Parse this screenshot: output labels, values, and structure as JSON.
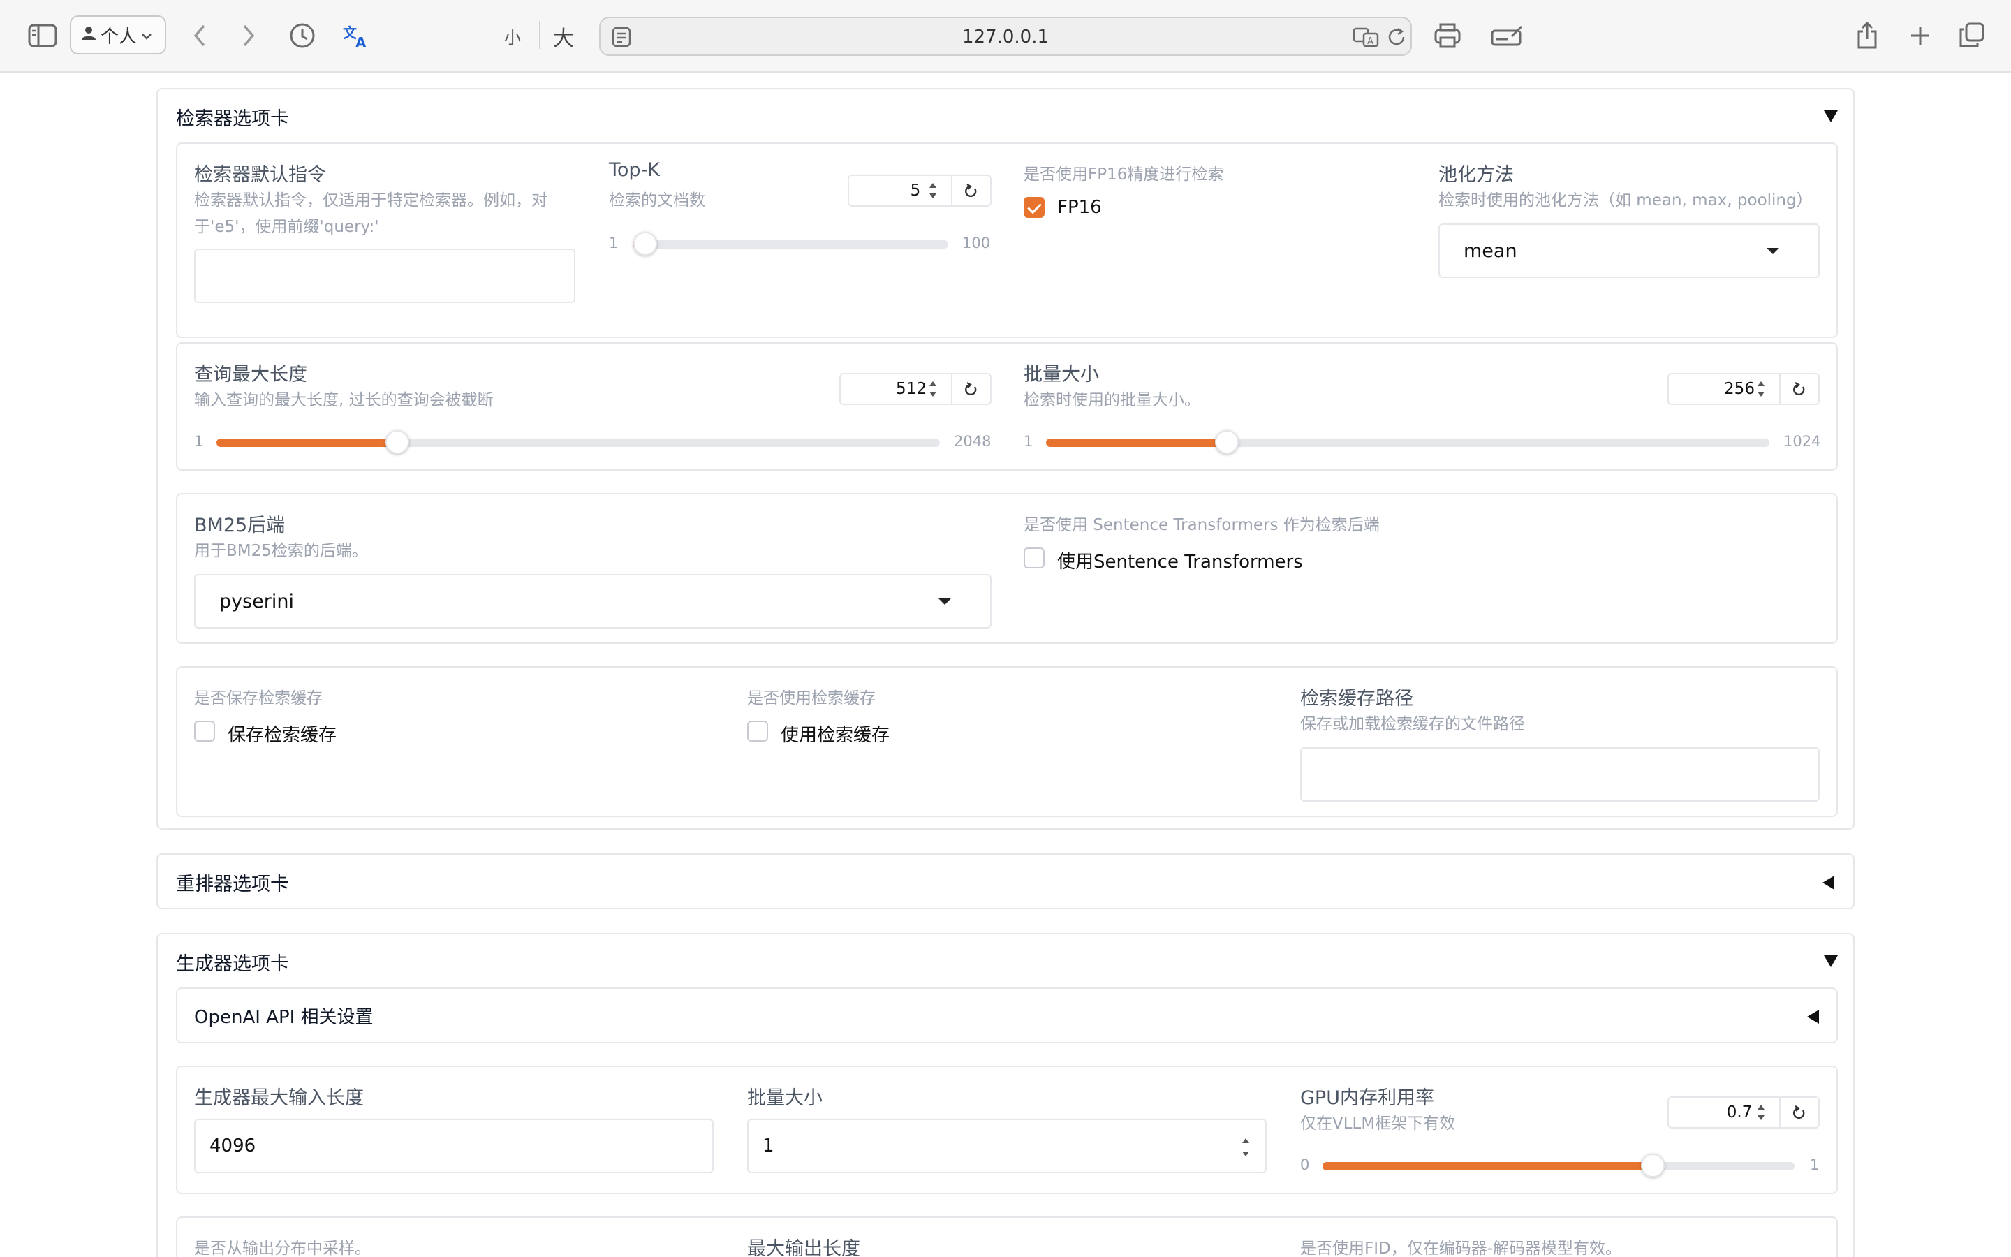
{
  "browser": {
    "profile_label": "个人",
    "font_small": "小",
    "font_large": "大",
    "url": "127.0.0.1"
  },
  "retriever": {
    "title": "检索器选项卡",
    "instruction": {
      "label": "检索器默认指令",
      "info_line1": "检索器默认指令，仅适用于特定检索器。例如，对",
      "info_line2": "于'e5'，使用前缀'query:'",
      "value": ""
    },
    "topk": {
      "label": "Top-K",
      "info": "检索的文档数",
      "value": "5",
      "min": "1",
      "max": "100",
      "fraction": 0.04
    },
    "fp16": {
      "info": "是否使用FP16精度进行检索",
      "label": "FP16",
      "checked": true
    },
    "pooling": {
      "label": "池化方法",
      "info": "检索时使用的池化方法（如 mean, max, pooling）",
      "value": "mean"
    },
    "query_len": {
      "label": "查询最大长度",
      "info": "输入查询的最大长度, 过长的查询会被截断",
      "value": "512",
      "min": "1",
      "max": "2048",
      "fraction": 0.25
    },
    "batch": {
      "label": "批量大小",
      "info": "检索时使用的批量大小。",
      "value": "256",
      "min": "1",
      "max": "1024",
      "fraction": 0.25
    },
    "bm25": {
      "label": "BM25后端",
      "info": "用于BM25检索的后端。",
      "value": "pyserini"
    },
    "st": {
      "info": "是否使用 Sentence Transformers 作为检索后端",
      "label": "使用Sentence Transformers",
      "checked": false
    },
    "save_cache": {
      "info": "是否保存检索缓存",
      "label": "保存检索缓存",
      "checked": false
    },
    "use_cache": {
      "info": "是否使用检索缓存",
      "label": "使用检索缓存",
      "checked": false
    },
    "cache_path": {
      "label": "检索缓存路径",
      "info": "保存或加载检索缓存的文件路径",
      "value": ""
    }
  },
  "reranker": {
    "title": "重排器选项卡"
  },
  "generator": {
    "title": "生成器选项卡",
    "openai_title": "OpenAI API 相关设置",
    "max_input": {
      "label": "生成器最大输入长度",
      "value": "4096"
    },
    "batch": {
      "label": "批量大小",
      "value": "1"
    },
    "gpu": {
      "label": "GPU内存利用率",
      "info": "仅在VLLM框架下有效",
      "value": "0.7",
      "min": "0",
      "max": "1",
      "fraction": 0.7
    },
    "sample_info": "是否从输出分布中采样。",
    "max_output_label": "最大输出长度",
    "fid_info": "是否使用FID，仅在编码器-解码器模型有效。"
  },
  "colors": {
    "accent": "#e8732f",
    "translate_icon": "#1a5fd6",
    "border": "#e5e7eb"
  }
}
